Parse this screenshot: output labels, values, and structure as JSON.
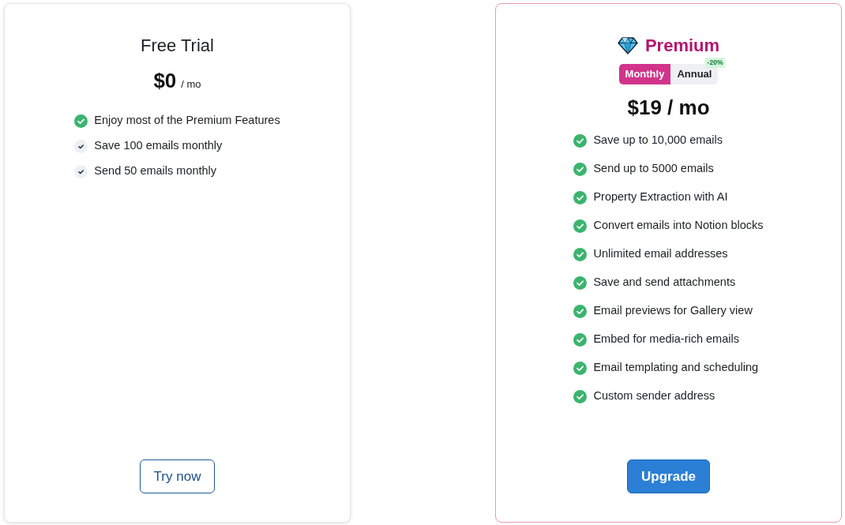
{
  "plans": [
    {
      "kind": "basic",
      "name": "Free Trial",
      "price": {
        "amount": "$0",
        "period": "/ mo"
      },
      "features": [
        {
          "text": "Enjoy most of the Premium Features",
          "highlighted": true
        },
        {
          "text": "Save 100 emails monthly",
          "highlighted": false
        },
        {
          "text": "Send 50 emails monthly",
          "highlighted": false
        }
      ],
      "button": {
        "label": "Try now",
        "kind": "outline"
      }
    },
    {
      "kind": "premium",
      "name": "Premium",
      "billing_toggle": [
        {
          "label": "Monthly",
          "selected": true
        },
        {
          "label": "Annual",
          "selected": false,
          "badge": "-20%"
        }
      ],
      "price": {
        "amount": "$19 / mo"
      },
      "features": [
        {
          "text": "Save up to 10,000 emails",
          "highlighted": true
        },
        {
          "text": "Send up to 5000 emails",
          "highlighted": true
        },
        {
          "text": "Property Extraction with AI",
          "highlighted": true
        },
        {
          "text": "Convert emails into Notion blocks",
          "highlighted": true
        },
        {
          "text": "Unlimited email addresses",
          "highlighted": true
        },
        {
          "text": "Save and send attachments",
          "highlighted": true
        },
        {
          "text": "Email previews for Gallery view",
          "highlighted": true
        },
        {
          "text": "Embed for media-rich emails",
          "highlighted": true
        },
        {
          "text": "Email templating and scheduling",
          "highlighted": true
        },
        {
          "text": "Custom sender address",
          "highlighted": true
        }
      ],
      "button": {
        "label": "Upgrade",
        "kind": "solid"
      }
    }
  ]
}
